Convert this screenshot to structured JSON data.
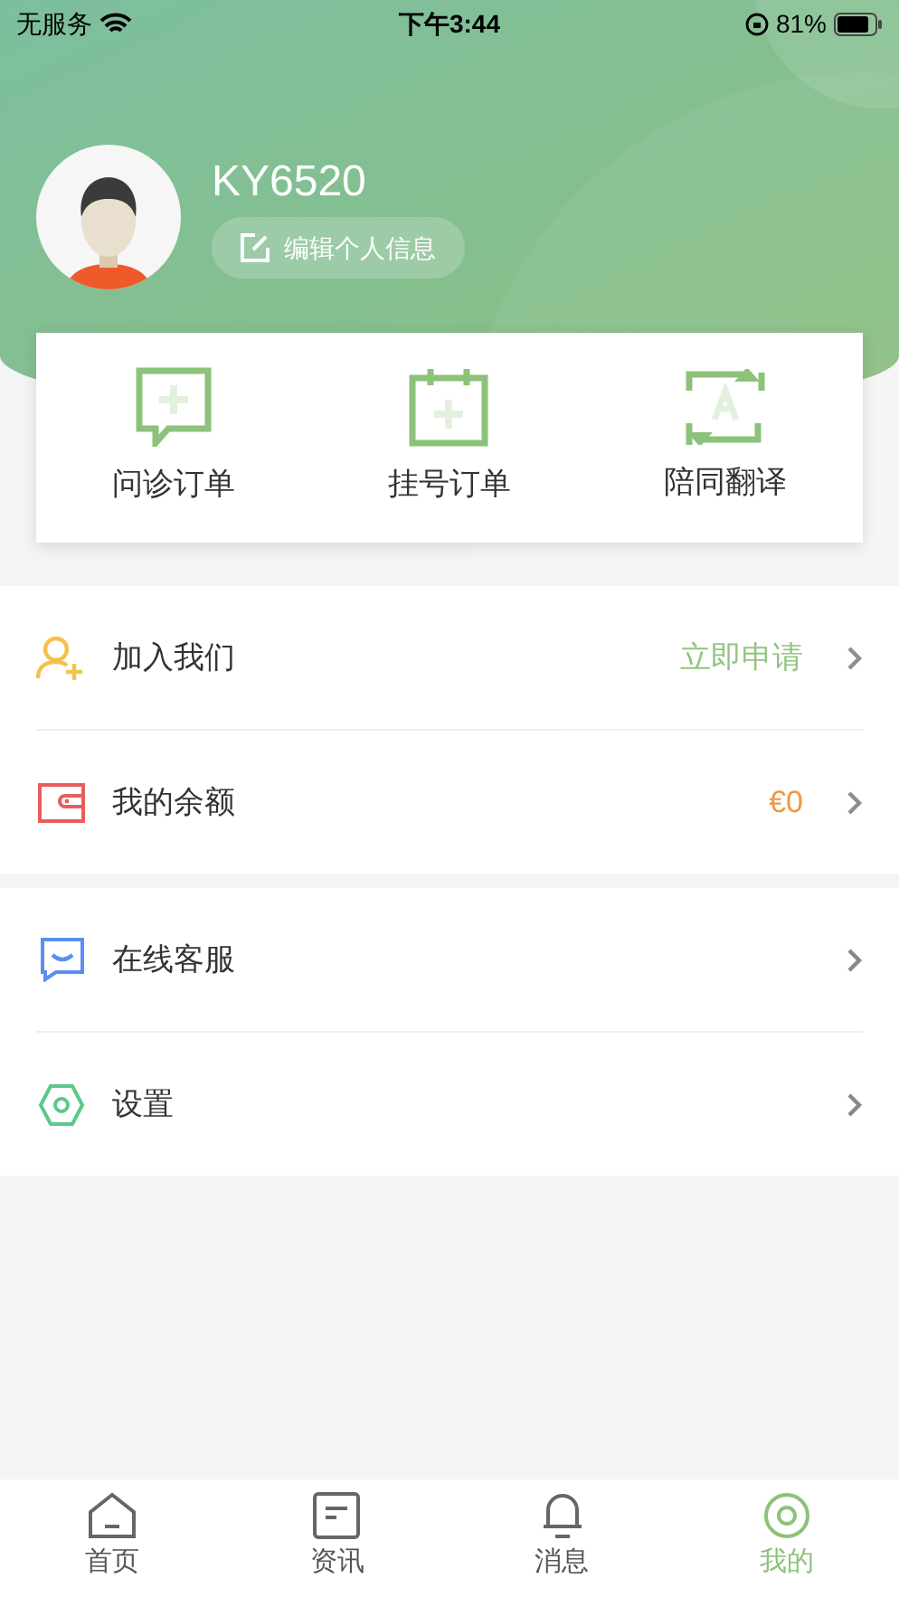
{
  "status_bar": {
    "carrier": "无服务",
    "time": "下午3:44",
    "battery": "81%"
  },
  "profile": {
    "name": "KY6520",
    "edit_label": "编辑个人信息"
  },
  "quick_actions": [
    {
      "kind": "consult",
      "label": "问诊订单"
    },
    {
      "kind": "register",
      "label": "挂号订单"
    },
    {
      "kind": "translate",
      "label": "陪同翻译"
    }
  ],
  "menu_groups": [
    {
      "items": [
        {
          "kind": "join",
          "label": "加入我们",
          "value": "立即申请"
        },
        {
          "kind": "wallet",
          "label": "我的余额",
          "value": "€0"
        }
      ]
    },
    {
      "items": [
        {
          "kind": "service",
          "label": "在线客服"
        },
        {
          "kind": "settings",
          "label": "设置"
        }
      ]
    }
  ],
  "tab_bar": [
    {
      "kind": "home",
      "label": "首页",
      "selected": false
    },
    {
      "kind": "news",
      "label": "资讯",
      "selected": false
    },
    {
      "kind": "bell",
      "label": "消息",
      "selected": false
    },
    {
      "kind": "mine",
      "label": "我的",
      "selected": true
    }
  ]
}
